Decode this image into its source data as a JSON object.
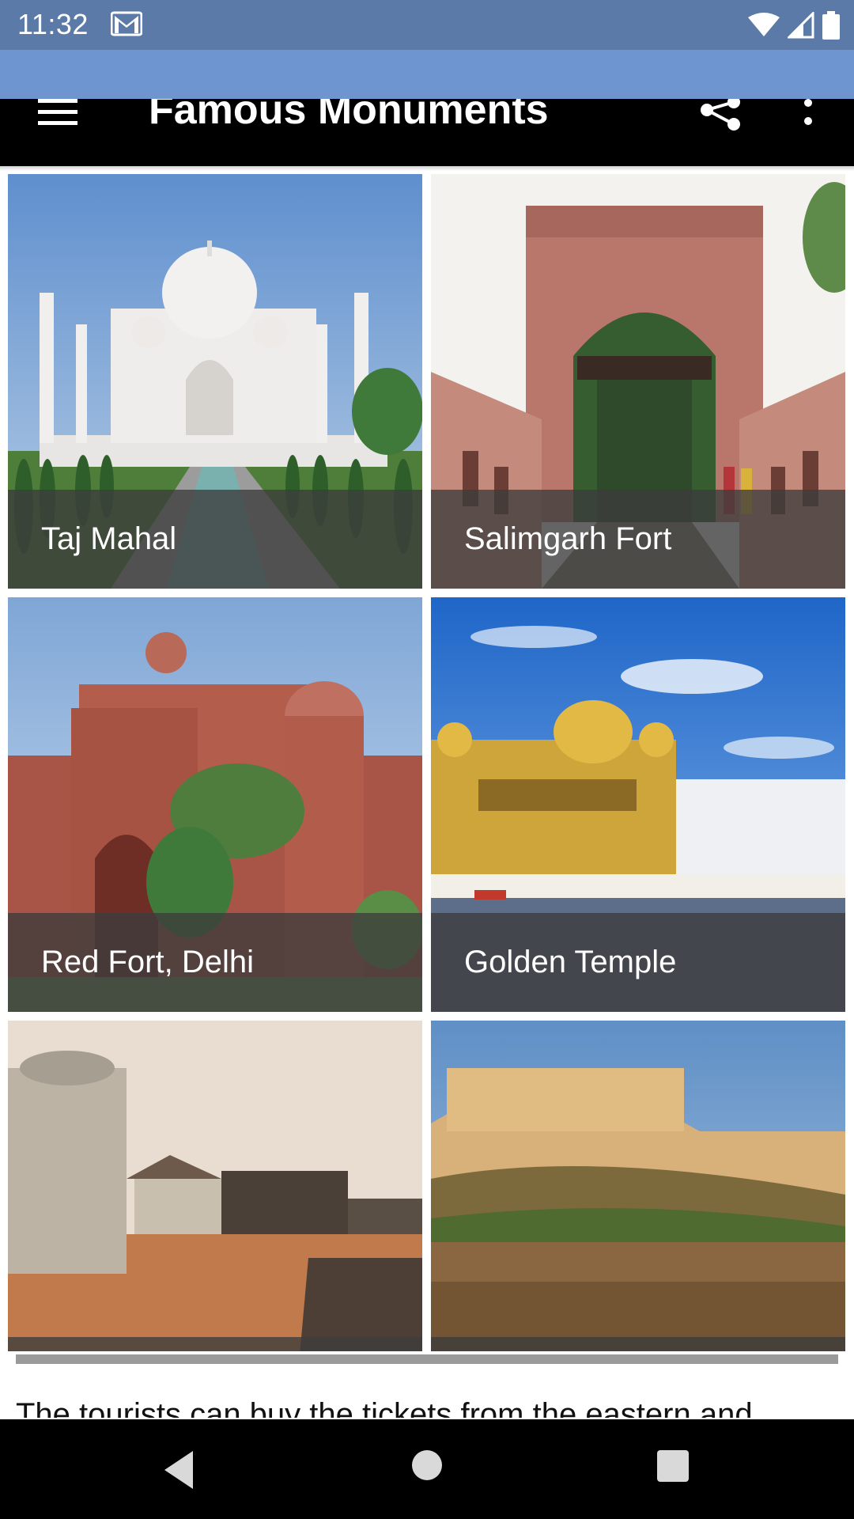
{
  "status_bar": {
    "time": "11:32",
    "left_icon": "gmail-notification-icon",
    "right_icons": [
      "wifi-icon",
      "cellular-signal-icon",
      "battery-icon"
    ]
  },
  "toolbar": {
    "title": "Famous Monuments",
    "menu_icon": "hamburger-menu-icon",
    "share_icon": "share-icon",
    "more_icon": "more-vertical-icon"
  },
  "monuments": [
    {
      "name": "Taj Mahal"
    },
    {
      "name": "Salimgarh Fort"
    },
    {
      "name": "Red Fort, Delhi"
    },
    {
      "name": "Golden Temple"
    },
    {
      "name": ""
    },
    {
      "name": ""
    }
  ],
  "article": {
    "text": "The tourists can buy the tickets from the eastern and"
  },
  "nav_bar": {
    "back_icon": "back-triangle-icon",
    "home_icon": "home-circle-icon",
    "recents_icon": "recents-square-icon"
  },
  "colors": {
    "status_bar": "#5b7aa8",
    "app_band": "#6e95cf",
    "toolbar": "#000000",
    "label_overlay": "#3c3c3c"
  }
}
